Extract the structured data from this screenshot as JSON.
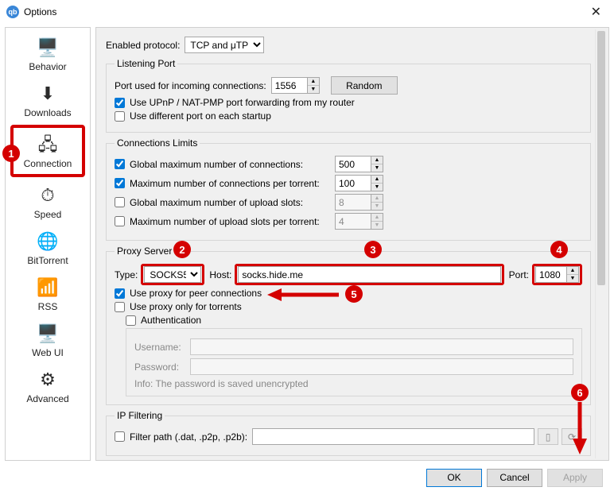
{
  "window": {
    "title": "Options",
    "close_glyph": "✕",
    "app_glyph": "qb"
  },
  "sidebar": {
    "items": [
      {
        "label": "Behavior",
        "glyph": "🖥️"
      },
      {
        "label": "Downloads",
        "glyph": "⬇"
      },
      {
        "label": "Connection",
        "glyph": "🖧"
      },
      {
        "label": "Speed",
        "glyph": "⏱"
      },
      {
        "label": "BitTorrent",
        "glyph": "🌐"
      },
      {
        "label": "RSS",
        "glyph": "📶"
      },
      {
        "label": "Web UI",
        "glyph": "🖥️"
      },
      {
        "label": "Advanced",
        "glyph": "⚙"
      }
    ]
  },
  "protocol": {
    "label": "Enabled protocol:",
    "value": "TCP and μTP"
  },
  "listening": {
    "legend": "Listening Port",
    "port_label": "Port used for incoming connections:",
    "port_value": "1556",
    "random_label": "Random",
    "upnp_label": "Use UPnP / NAT-PMP port forwarding from my router",
    "upnp_checked": true,
    "diffport_label": "Use different port on each startup",
    "diffport_checked": false
  },
  "limits": {
    "legend": "Connections Limits",
    "rows": [
      {
        "label": "Global maximum number of connections:",
        "value": "500",
        "checked": true,
        "enabled": true
      },
      {
        "label": "Maximum number of connections per torrent:",
        "value": "100",
        "checked": true,
        "enabled": true
      },
      {
        "label": "Global maximum number of upload slots:",
        "value": "8",
        "checked": false,
        "enabled": false
      },
      {
        "label": "Maximum number of upload slots per torrent:",
        "value": "4",
        "checked": false,
        "enabled": false
      }
    ]
  },
  "proxy": {
    "legend": "Proxy Server",
    "type_label": "Type:",
    "type_value": "SOCKS5",
    "host_label": "Host:",
    "host_value": "socks.hide.me",
    "port_label": "Port:",
    "port_value": "1080",
    "peer_label": "Use proxy for peer connections",
    "peer_checked": true,
    "torrents_only_label": "Use proxy only for torrents",
    "torrents_only_checked": false,
    "auth_label": "Authentication",
    "auth_checked": false,
    "user_label": "Username:",
    "pass_label": "Password:",
    "info": "Info: The password is saved unencrypted"
  },
  "ipfilter": {
    "legend": "IP Filtering",
    "path_label": "Filter path (.dat, .p2p, .p2b):",
    "path_value": ""
  },
  "buttons": {
    "ok": "OK",
    "cancel": "Cancel",
    "apply": "Apply"
  },
  "callouts": {
    "c1": "1",
    "c2": "2",
    "c3": "3",
    "c4": "4",
    "c5": "5",
    "c6": "6"
  },
  "annotation_colors": {
    "highlight": "#d40000"
  }
}
